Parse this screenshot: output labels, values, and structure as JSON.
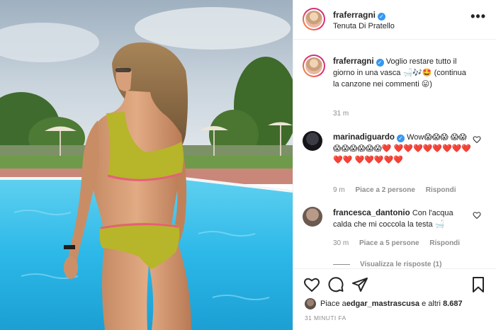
{
  "post": {
    "username": "fraferragni",
    "location": "Tenuta Di Pratello",
    "more_label": "•••"
  },
  "caption": {
    "username": "fraferragni",
    "text": "Voglio restare tutto il giorno in una vasca 🛁🎶🤩 (continua la canzone nei commenti 😛)",
    "time": "31 m"
  },
  "comments": [
    {
      "username": "marinadiguardo",
      "verified": true,
      "text": "Wow😱😱😱 😱😱😱😱😱😱😱😱❤️ ❤️❤️❤️❤️❤️❤️❤️❤️❤️❤️ ❤️❤️❤️❤️❤️",
      "time": "9 m",
      "likes": "Piace a 2 persone",
      "reply": "Rispondi"
    },
    {
      "username": "francesca_dantonio",
      "verified": false,
      "text": "Con l'acqua calda che mi coccola la testa 🛁",
      "time": "30 m",
      "likes": "Piace a 5 persone",
      "reply": "Rispondi",
      "view_replies": "Visualizza le risposte (1)"
    }
  ],
  "footer": {
    "likes_prefix": "Piace a ",
    "likes_user": "edgar_mastrascusa",
    "likes_mid": " e altri ",
    "likes_count": "8.687",
    "timestamp": "31 MINUTI FA"
  },
  "icons": {
    "like": "heart-icon",
    "comment": "comment-icon",
    "share": "share-icon",
    "save": "bookmark-icon"
  },
  "colors": {
    "verified": "#3897f0",
    "pool": "#2cb8e8",
    "bikini": "#b7b52a"
  }
}
